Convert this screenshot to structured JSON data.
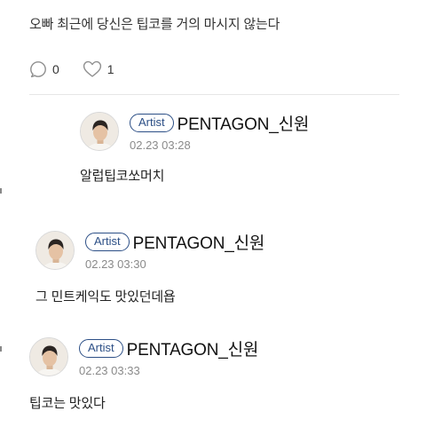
{
  "post": {
    "text": "오빠 최근에 당신은 팁코를 거의 마시지 않는다"
  },
  "actions": {
    "comment": {
      "icon": "comment-bubble-icon",
      "count": "0"
    },
    "like": {
      "icon": "heart-icon",
      "count": "1"
    }
  },
  "replies": [
    {
      "badge": "Artist",
      "author": "PENTAGON_신원",
      "timestamp": "02.23 03:28",
      "text": "알럽팁코쏘머치"
    },
    {
      "badge": "Artist",
      "author": "PENTAGON_신원",
      "timestamp": "02.23 03:30",
      "text": "그 민트케익도 맛있던데욥"
    },
    {
      "badge": "Artist",
      "author": "PENTAGON_신원",
      "timestamp": "02.23 03:33",
      "text": "팁코는 맛있다"
    }
  ],
  "colors": {
    "badge_border": "#2c4f86",
    "timestamp": "#8a8a8a",
    "divider": "#e6e6e6"
  }
}
